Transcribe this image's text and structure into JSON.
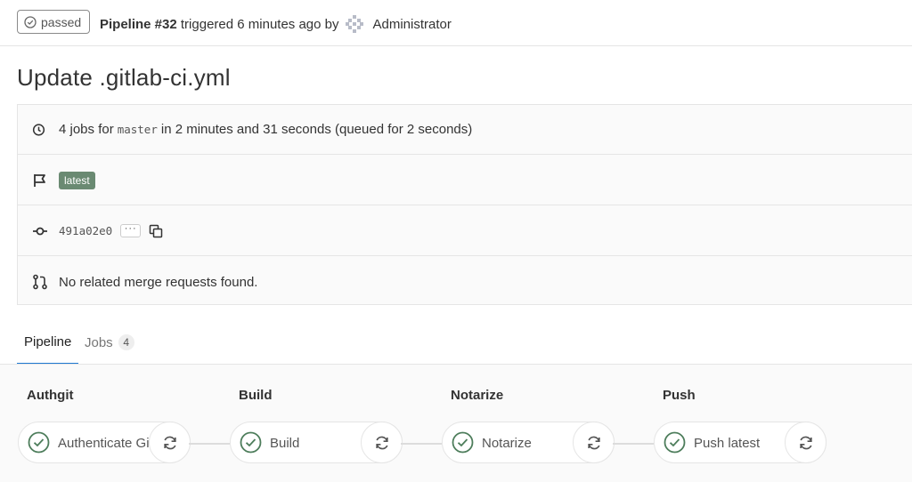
{
  "header": {
    "status": "passed",
    "pipeline_label": "Pipeline #32",
    "triggered_text": "triggered 6 minutes ago by",
    "user": "Administrator"
  },
  "title": "Update .gitlab-ci.yml",
  "info": {
    "jobs_prefix": "4 jobs for",
    "branch": "master",
    "jobs_suffix": "in 2 minutes and 31 seconds (queued for 2 seconds)",
    "tag": "latest",
    "commit_sha": "491a02e0",
    "ellipsis": "···",
    "merge_requests": "No related merge requests found."
  },
  "tabs": {
    "pipeline": "Pipeline",
    "jobs": "Jobs",
    "jobs_count": "4"
  },
  "stages": [
    {
      "name": "Authgit",
      "job": "Authenticate Git"
    },
    {
      "name": "Build",
      "job": "Build"
    },
    {
      "name": "Notarize",
      "job": "Notarize"
    },
    {
      "name": "Push",
      "job": "Push latest"
    }
  ],
  "colors": {
    "success": "#4d7d5b",
    "tag_bg": "#6a8a72",
    "tab_active": "#1f78d1"
  }
}
